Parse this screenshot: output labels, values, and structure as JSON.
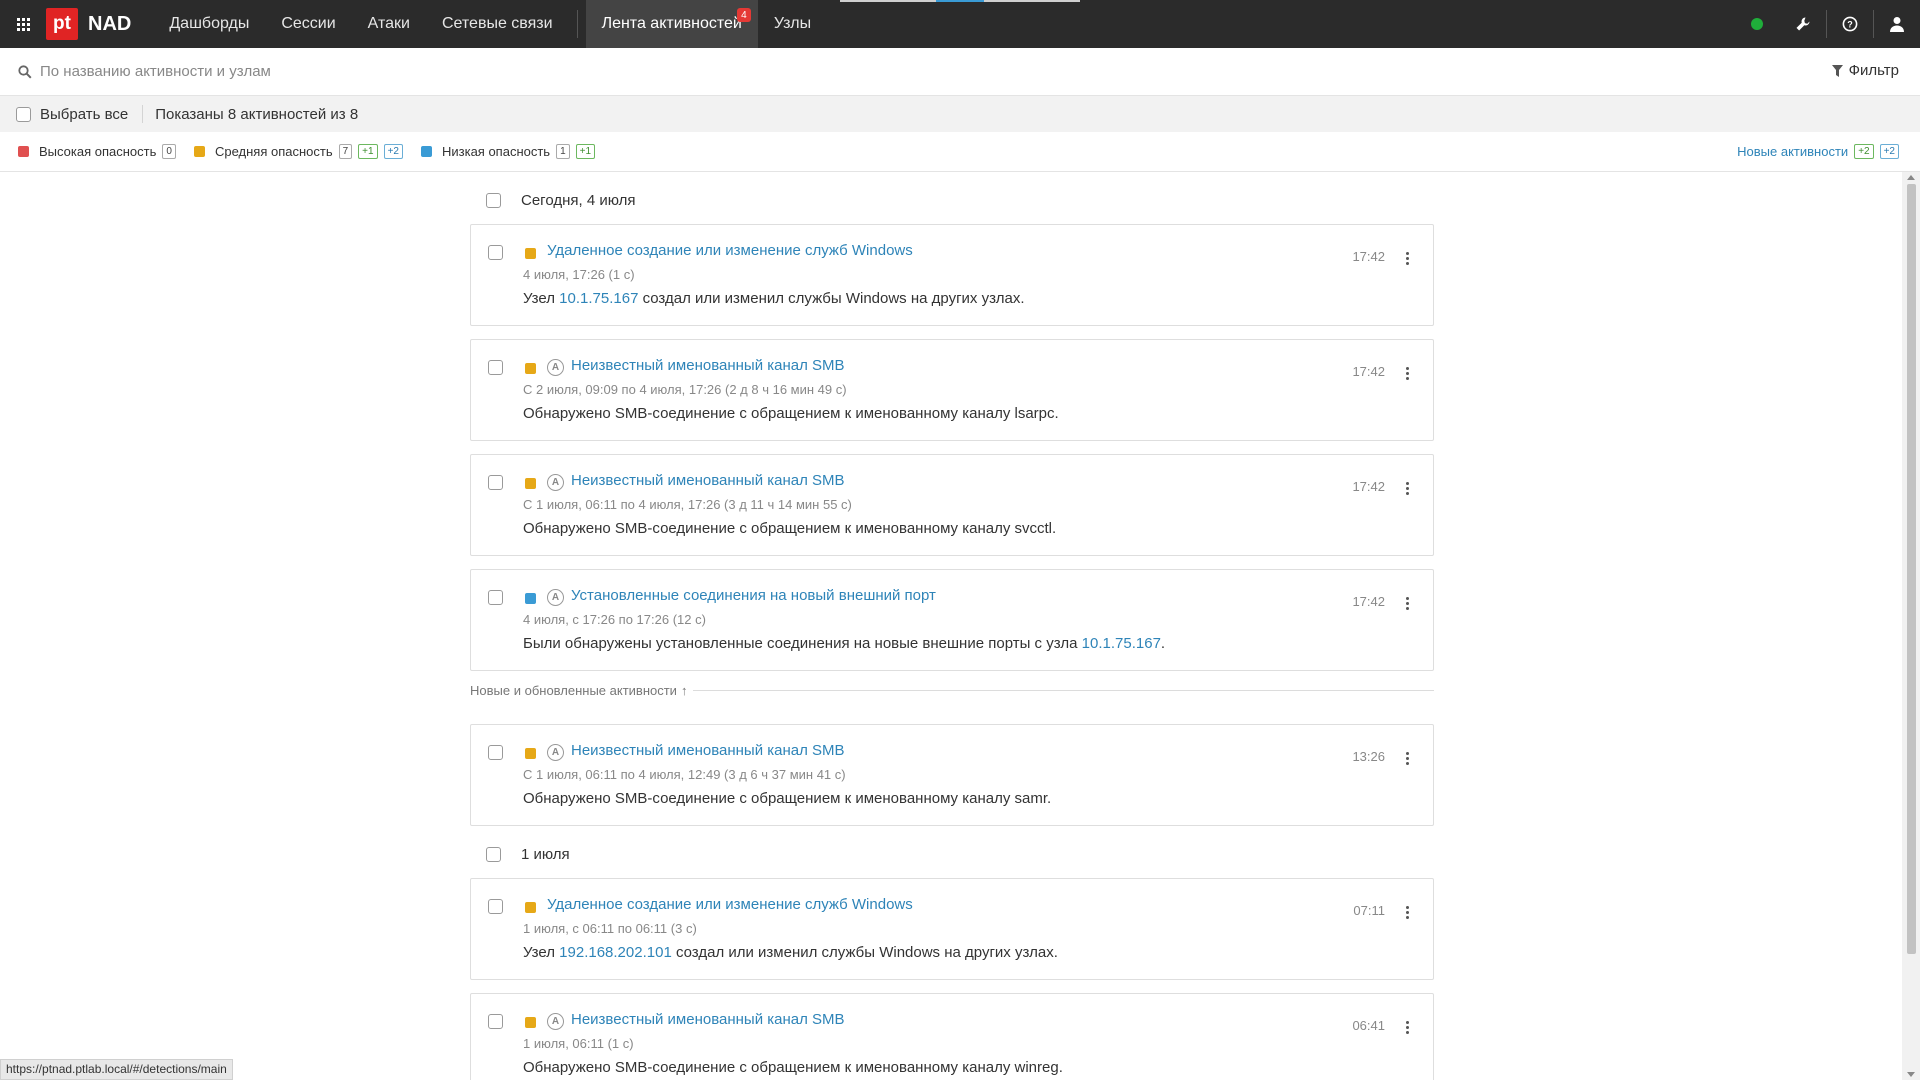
{
  "app": {
    "logo_text": "pt",
    "name": "NAD"
  },
  "nav": {
    "items": [
      {
        "label": "Дашборды"
      },
      {
        "label": "Сессии"
      },
      {
        "label": "Атаки"
      },
      {
        "label": "Сетевые связи"
      },
      {
        "label": "Лента активностей",
        "active": true,
        "badge": "4"
      },
      {
        "label": "Узлы"
      }
    ],
    "status_color": "#1fae3a"
  },
  "search": {
    "placeholder": "По названию активности и узлам",
    "filter_label": "Фильтр"
  },
  "selection": {
    "select_all_label": "Выбрать все",
    "shown_text": "Показаны 8 активностей из 8"
  },
  "legend": {
    "high": {
      "label": "Высокая опасность",
      "color": "#e05050",
      "count": "0"
    },
    "medium": {
      "label": "Средняя опасность",
      "color": "#e6a817",
      "count": "7",
      "plus1": "+1",
      "plus2": "+2"
    },
    "low": {
      "label": "Низкая опасность",
      "color": "#3a9bd5",
      "count": "1",
      "plus1": "+1"
    },
    "new_label": "Новые активности",
    "new_green": "+2",
    "new_blue": "+2"
  },
  "feed": {
    "day1": "Сегодня, 4 июля",
    "day2": "1 июля",
    "updated_label": "Новые и обновленные активности",
    "updated_arrow": "↑",
    "cards": [
      {
        "title": "Удаленное создание или изменение служб Windows",
        "period": "4 июля, 17:26 (1 с)",
        "desc_pre": "Узел ",
        "desc_link": "10.1.75.167",
        "desc_post": " создал или изменил службы Windows на других узлах.",
        "time": "17:42",
        "severity": "medium",
        "auto": false
      },
      {
        "title": "Неизвестный именованный канал SMB",
        "period": "С 2 июля, 09:09 по 4 июля, 17:26 (2 д 8 ч 16 мин 49 с)",
        "desc_pre": "Обнаружено SMB-соединение с обращением к именованному каналу lsarpc.",
        "desc_link": "",
        "desc_post": "",
        "time": "17:42",
        "severity": "medium",
        "auto": true
      },
      {
        "title": "Неизвестный именованный канал SMB",
        "period": "С 1 июля, 06:11 по 4 июля, 17:26 (3 д 11 ч 14 мин 55 с)",
        "desc_pre": "Обнаружено SMB-соединение с обращением к именованному каналу svcctl.",
        "desc_link": "",
        "desc_post": "",
        "time": "17:42",
        "severity": "medium",
        "auto": true
      },
      {
        "title": "Установленные соединения на новый внешний порт",
        "period": "4 июля, с 17:26 по 17:26 (12 с)",
        "desc_pre": "Были обнаружены установленные соединения на новые внешние порты с узла ",
        "desc_link": "10.1.75.167",
        "desc_post": ".",
        "time": "17:42",
        "severity": "low",
        "auto": true
      },
      {
        "title": "Неизвестный именованный канал SMB",
        "period": "С 1 июля, 06:11 по 4 июля, 12:49 (3 д 6 ч 37 мин 41 с)",
        "desc_pre": "Обнаружено SMB-соединение с обращением к именованному каналу samr.",
        "desc_link": "",
        "desc_post": "",
        "time": "13:26",
        "severity": "medium",
        "auto": true
      },
      {
        "title": "Удаленное создание или изменение служб Windows",
        "period": "1 июля, с 06:11 по 06:11 (3 с)",
        "desc_pre": "Узел ",
        "desc_link": "192.168.202.101",
        "desc_post": " создал или изменил службы Windows на других узлах.",
        "time": "07:11",
        "severity": "medium",
        "auto": false
      },
      {
        "title": "Неизвестный именованный канал SMB",
        "period": "1 июля, 06:11 (1 с)",
        "desc_pre": "Обнаружено SMB-соединение с обращением к именованному каналу winreg.",
        "desc_link": "",
        "desc_post": "",
        "time": "06:41",
        "severity": "medium",
        "auto": true
      }
    ]
  },
  "auto_icon": "A",
  "status_url": "https://ptnad.ptlab.local/#/detections/main"
}
